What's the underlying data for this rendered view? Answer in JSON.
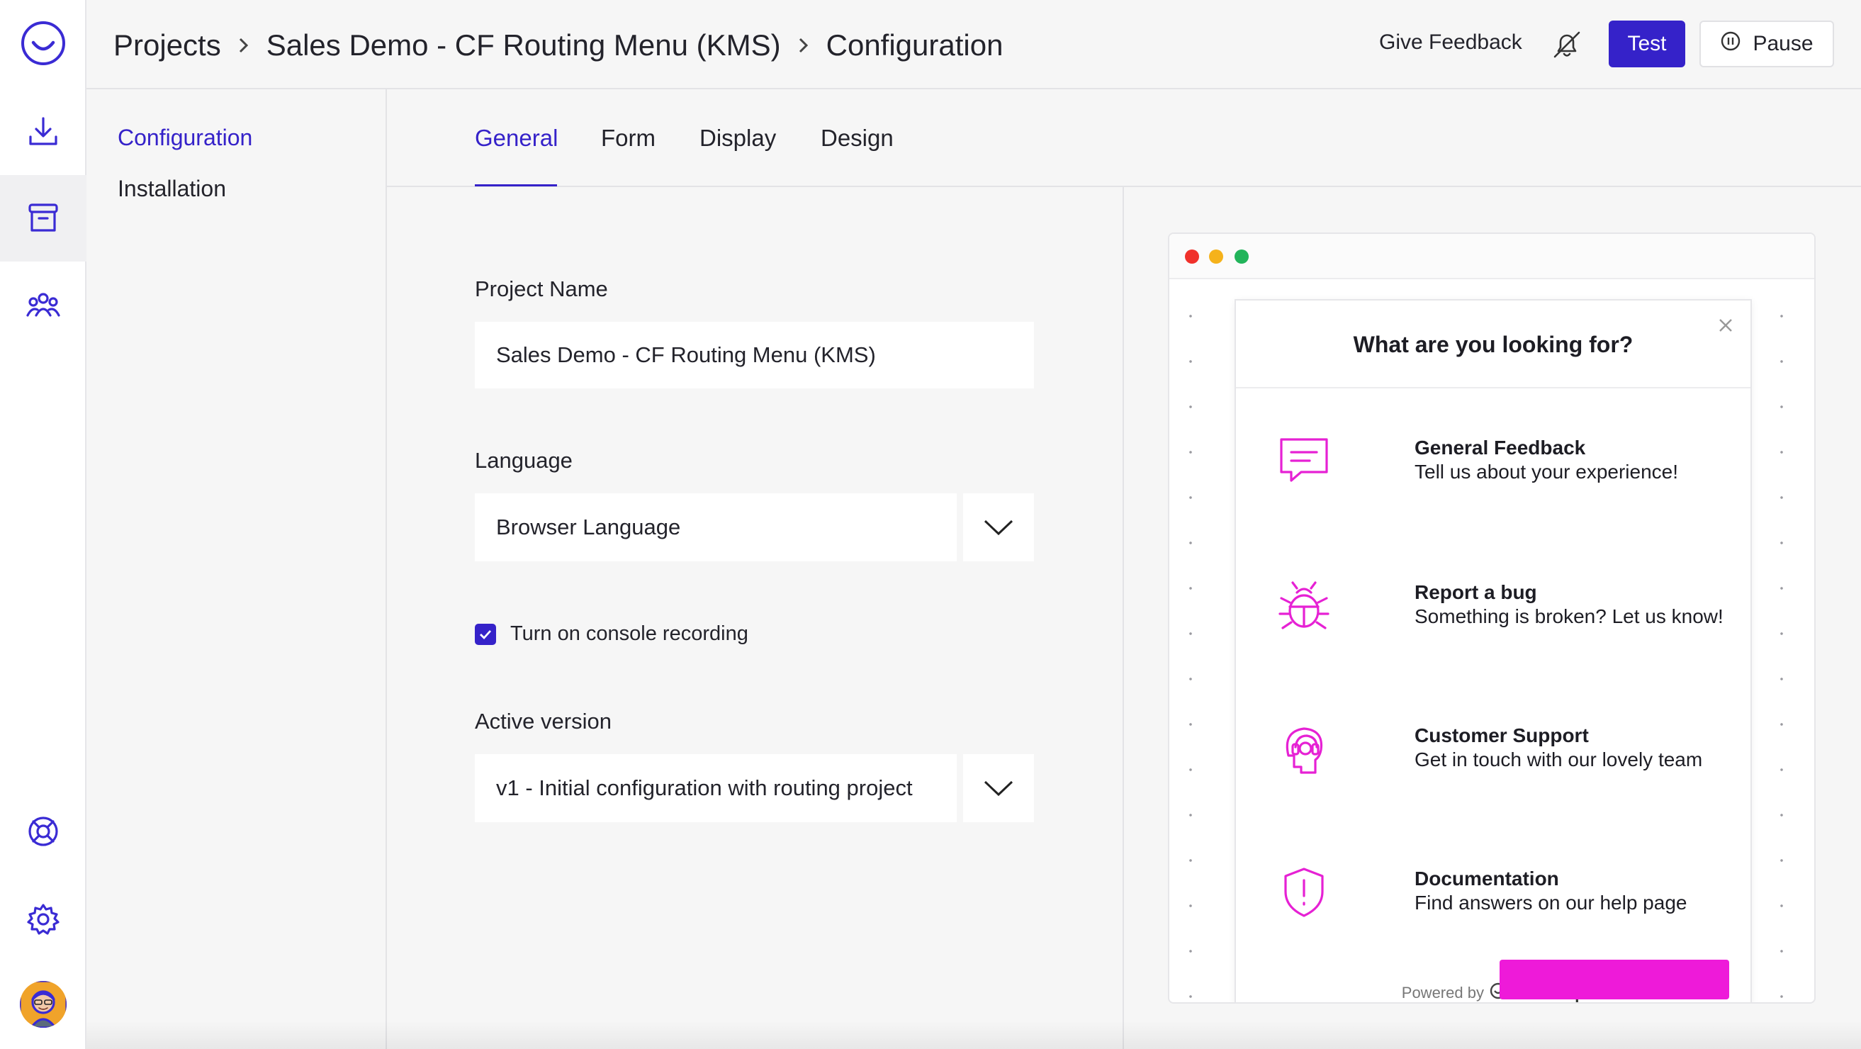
{
  "breadcrumb": {
    "items": [
      "Projects",
      "Sales Demo - CF Routing Menu (KMS)",
      "Configuration"
    ]
  },
  "header": {
    "give_feedback": "Give Feedback",
    "test_label": "Test",
    "pause_label": "Pause"
  },
  "sidebar": {
    "icons": [
      "logo-icon",
      "download-icon",
      "archive-box-icon",
      "team-icon",
      "lifebuoy-icon",
      "gear-icon"
    ],
    "active_index": 2
  },
  "subnav": {
    "items": [
      "Configuration",
      "Installation"
    ],
    "active": "Configuration"
  },
  "tabs": {
    "items": [
      "General",
      "Form",
      "Display",
      "Design"
    ],
    "active": "General"
  },
  "form": {
    "project_name_label": "Project Name",
    "project_name_value": "Sales Demo - CF Routing Menu (KMS)",
    "language_label": "Language",
    "language_value": "Browser Language",
    "console_recording_label": "Turn on console recording",
    "console_recording_checked": true,
    "active_version_label": "Active version",
    "active_version_value": "v1 - Initial configuration with routing project"
  },
  "preview": {
    "widget_title": "What are you looking for?",
    "options": [
      {
        "icon": "chat-bubble-icon",
        "title": "General Feedback",
        "desc": "Tell us about your experience!"
      },
      {
        "icon": "bug-icon",
        "title": "Report a bug",
        "desc": "Something is broken? Let us know!"
      },
      {
        "icon": "headset-icon",
        "title": "Customer Support",
        "desc": "Get in touch with our lovely team"
      },
      {
        "icon": "shield-alert-icon",
        "title": "Documentation",
        "desc": "Find answers on our help page"
      }
    ],
    "powered_by": "Powered by",
    "brand": "usersnap",
    "colors": {
      "accent": "#e621d4",
      "traffic": [
        "#f0312b",
        "#f5b21b",
        "#22b45a"
      ]
    }
  },
  "colors": {
    "primary": "#3522c9",
    "background": "#f6f6f6"
  }
}
